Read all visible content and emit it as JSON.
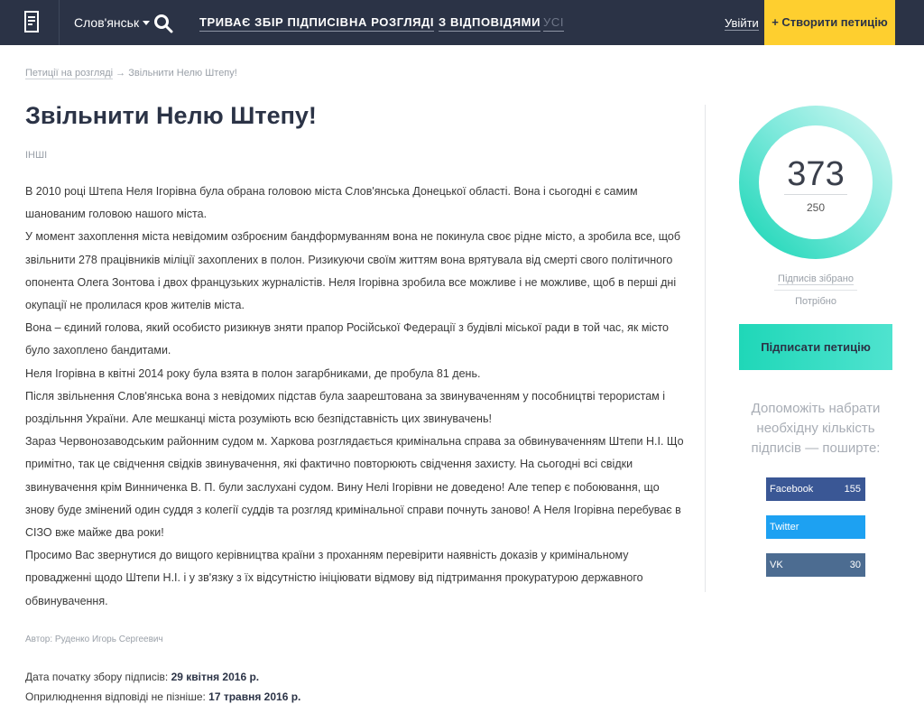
{
  "header": {
    "city": "Слов'янськ",
    "nav": [
      {
        "label": "ТРИВАЄ ЗБІР ПІДПИСІВ"
      },
      {
        "label": "НА РОЗГЛЯДІ"
      },
      {
        "label": "З ВІДПОВІДЯМИ"
      },
      {
        "label": "УСІ"
      }
    ],
    "login": "Увійти",
    "create": "+ Створити петицію"
  },
  "breadcrumb": {
    "link": "Петиції на розгляді",
    "arrow": "→",
    "current": "Звільнити Нелю Штепу!"
  },
  "petition": {
    "title": "Звільнити Нелю Штепу!",
    "category": "ІНШІ",
    "paragraphs": [
      "В 2010 році Штепа Неля Ігорівна була обрана головою міста Слов'янська Донецької області. Вона і сьогодні є самим шанованим головою нашого міста.",
      "У момент захоплення міста невідомим озброєним бандформуванням вона не покинула своє рідне місто, а зробила все, щоб звільнити 278 працівників міліції захоплених в полон. Ризикуючи своїм життям вона врятувала від смерті свого політичного опонента Олега Зонтова і двох французьких журналістів. Неля Ігорівна зробила все можливе і не можливе, щоб в перші дні окупації не пролилася кров жителів міста.",
      "Вона – єдиний голова, який особисто ризикнув зняти прапор Російської Федерації з будівлі міської ради в той час, як місто було захоплено бандитами.",
      "Неля Ігорівна в квітні 2014 року була взята в полон загарбниками, де пробула 81 день.",
      "Після звільнення Слов'янська вона з невідомих підстав була заарештована за звинуваченням у пособництві терористам і роздільння України. Але мешканці міста розуміють всю безпідставність цих звинувачень!",
      "Зараз Червонозаводським районним судом м. Харкова розглядається кримінальна справа за обвинуваченням Штепи Н.І. Що примітно, так це свідчення свідків звинувачення, які фактично повторюють свідчення захисту. На сьогодні всі свідки звинувачення крім Винниченка В. П. були заслухані судом. Вину Нелі Ігорівни не доведено! Але тепер є побоювання, що знову буде змінений один суддя з колегії суддів та розгляд кримінальної справи почнуть заново! А Неля Ігорівна перебуває в СІЗО вже майже два роки!",
      "Просимо Вас звернутися до вищого керівництва країни з проханням перевірити наявність доказів у кримінальному провадженні щодо Штепи Н.І. і у зв'язку з їх відсутністю ініціювати відмову від підтримання прокуратурою державного обвинувачення."
    ],
    "author": "Автор: Руденко Игорь Сергеевич",
    "start_label": "Дата початку збору підписів: ",
    "start_date": "29 квітня 2016 р.",
    "deadline_label": "Оприлюднення відповіді не пізніше: ",
    "deadline_date": "17 травня 2016 р."
  },
  "sidebar": {
    "signatures": "373",
    "required": "250",
    "progress": 1.0,
    "collected_label": "Підписів зібрано",
    "needed_label": "Потрібно",
    "sign_button": "Підписати петицію",
    "share_text": "Допоможіть набрати необхідну кількість підписів — поширте:",
    "share": [
      {
        "label": "Facebook",
        "count": "155",
        "color": "#3a5795"
      },
      {
        "label": "Twitter",
        "count": "",
        "color": "#1da1f2"
      },
      {
        "label": "VK",
        "count": "30",
        "color": "#4c6c91"
      }
    ]
  },
  "colors": {
    "header_bg": "#2b3346",
    "accent_yellow": "#fecf2f",
    "accent_teal": "#1fd7b8"
  },
  "icons": [
    "document-logo-icon",
    "search-icon",
    "chevron-down-icon"
  ]
}
